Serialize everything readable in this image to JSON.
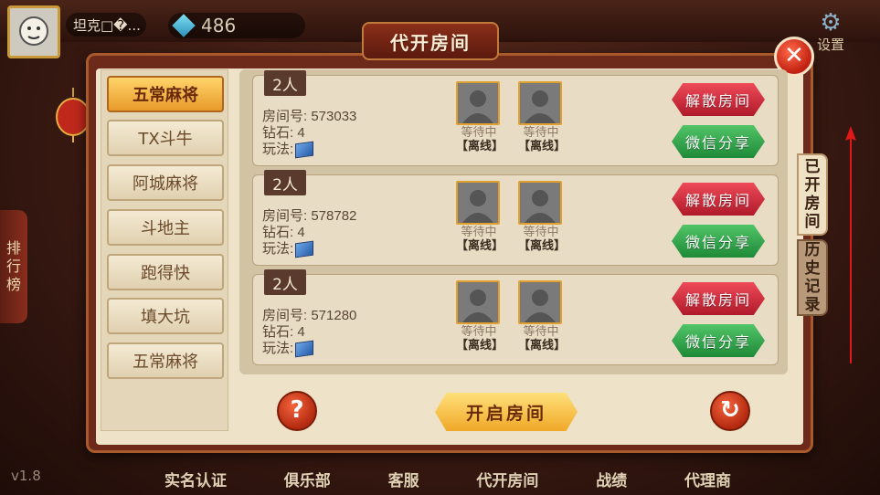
{
  "header": {
    "user_name": "坦克□�...",
    "diamonds": "486",
    "settings_label": "设置"
  },
  "side_left": {
    "ranking_label": [
      "排",
      "行",
      "榜"
    ],
    "version": "v1.8"
  },
  "dialog": {
    "title": "代开房间",
    "menu": [
      {
        "label": "五常麻将",
        "active": true
      },
      {
        "label": "TX斗牛",
        "active": false
      },
      {
        "label": "阿城麻将",
        "active": false
      },
      {
        "label": "斗地主",
        "active": false
      },
      {
        "label": "跑得快",
        "active": false
      },
      {
        "label": "填大坑",
        "active": false
      },
      {
        "label": "五常麻将",
        "active": false
      }
    ],
    "rooms": [
      {
        "players_tag": "2人",
        "room_no": "房间号: 573033",
        "diamonds": "钻石: 4",
        "play_label": "玩法:",
        "seats": [
          {
            "waiting": "等待中",
            "status": "【离线】"
          },
          {
            "waiting": "等待中",
            "status": "【离线】"
          }
        ],
        "dissolve_label": "解散房间",
        "share_label": "微信分享"
      },
      {
        "players_tag": "2人",
        "room_no": "房间号: 578782",
        "diamonds": "钻石: 4",
        "play_label": "玩法:",
        "seats": [
          {
            "waiting": "等待中",
            "status": "【离线】"
          },
          {
            "waiting": "等待中",
            "status": "【离线】"
          }
        ],
        "dissolve_label": "解散房间",
        "share_label": "微信分享"
      },
      {
        "players_tag": "2人",
        "room_no": "房间号: 571280",
        "diamonds": "钻石: 4",
        "play_label": "玩法:",
        "seats": [
          {
            "waiting": "等待中",
            "status": "【离线】"
          },
          {
            "waiting": "等待中",
            "status": "【离线】"
          }
        ],
        "dissolve_label": "解散房间",
        "share_label": "微信分享"
      }
    ],
    "tabs": {
      "opened": [
        "已",
        "开",
        "房",
        "间"
      ],
      "history": [
        "历",
        "史",
        "记",
        "录"
      ]
    },
    "help_label": "?",
    "open_room_label": "开启房间",
    "refresh_label": "↻",
    "close_label": "✕"
  },
  "bottom_nav": [
    "实名认证",
    "俱乐部",
    "客服",
    "代开房间",
    "战绩",
    "代理商"
  ],
  "colors": {
    "dialog_frame": "#6d2a1b",
    "panel_bg": "#eee3c8",
    "active_menu": "#f0a828",
    "dissolve_btn": "#d02a3a",
    "share_btn": "#2ea04a",
    "avatar_border": "#e0a030"
  }
}
